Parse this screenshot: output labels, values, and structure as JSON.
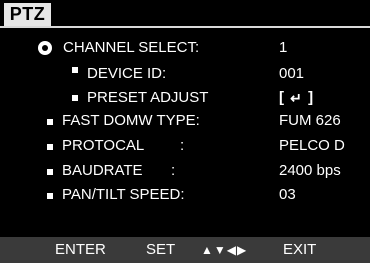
{
  "title": "PTZ",
  "colors": {
    "background": "#000000",
    "text": "#ffffff",
    "tab": "#e6e6e6",
    "footer": "#3a3a3a"
  },
  "menu": {
    "items": [
      {
        "label": "CHANNEL SELECT:",
        "value": "1",
        "icon": "ring-selector-icon"
      },
      {
        "label": "DEVICE ID:",
        "value": "001",
        "icon": "square-bullet-icon"
      },
      {
        "label": "PRESET ADJUST",
        "value_left": "[",
        "value_icon": "enter-icon",
        "value_right": "]",
        "icon": "square-bullet-icon"
      },
      {
        "label": "FAST DOMW TYPE:",
        "value": "FUM 626",
        "icon": "square-bullet-icon"
      },
      {
        "label": "PROTOCAL",
        "colon": ":",
        "value": "PELCO D",
        "icon": "square-bullet-icon"
      },
      {
        "label": "BAUDRATE",
        "colon": ":",
        "value": "2400 bps",
        "icon": "square-bullet-icon"
      },
      {
        "label": "PAN/TILT SPEED:",
        "value": "03",
        "icon": "square-bullet-icon"
      }
    ]
  },
  "footer": {
    "enter": "ENTER",
    "set": "SET",
    "arrows": "▲▼◀▶",
    "exit": "EXIT"
  }
}
